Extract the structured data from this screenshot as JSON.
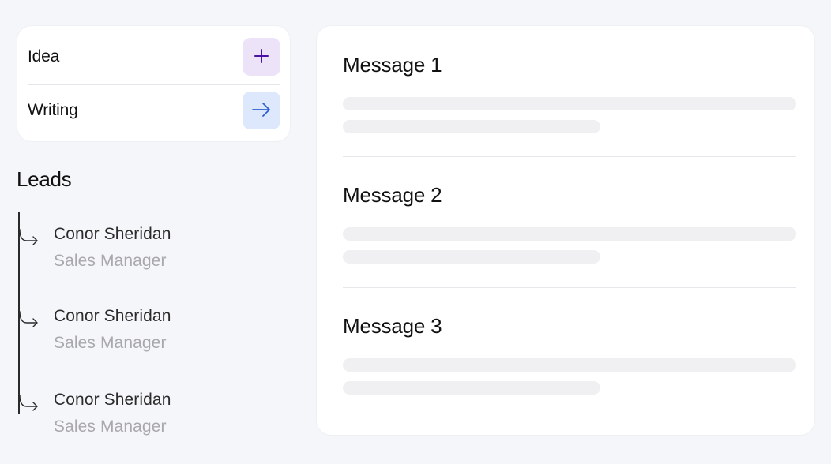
{
  "actions": [
    {
      "label": "Idea",
      "icon": "plus-icon",
      "button_bg": "#ece3f9",
      "icon_color": "#4a12a3"
    },
    {
      "label": "Writing",
      "icon": "arrow-right-icon",
      "button_bg": "#dde8fc",
      "icon_color": "#2f5fd0"
    }
  ],
  "leads": {
    "title": "Leads",
    "items": [
      {
        "name": "Conor Sheridan",
        "role": "Sales Manager"
      },
      {
        "name": "Conor Sheridan",
        "role": "Sales Manager"
      },
      {
        "name": "Conor Sheridan",
        "role": "Sales Manager"
      }
    ]
  },
  "messages": [
    {
      "title": "Message 1"
    },
    {
      "title": "Message 2"
    },
    {
      "title": "Message 3"
    }
  ]
}
